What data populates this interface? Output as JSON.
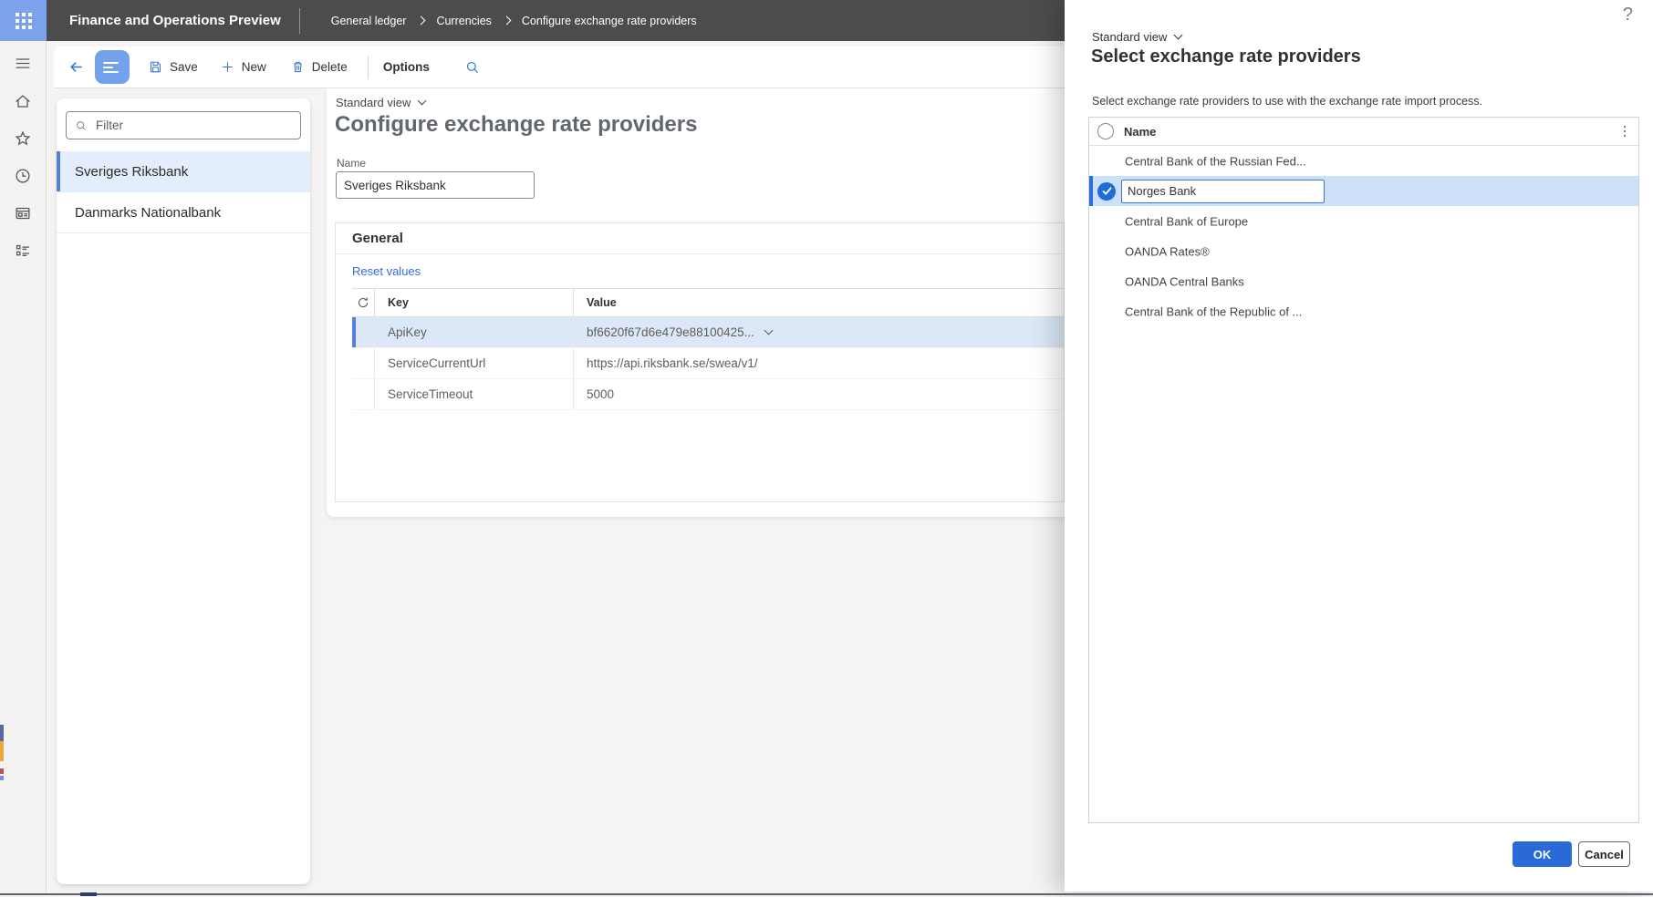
{
  "topbar": {
    "app_title": "Finance and Operations Preview",
    "breadcrumbs": [
      "General ledger",
      "Currencies",
      "Configure exchange rate providers"
    ]
  },
  "toolbar": {
    "save_label": "Save",
    "new_label": "New",
    "delete_label": "Delete",
    "options_label": "Options"
  },
  "nav_icons": [
    "menu-icon",
    "home-icon",
    "favorites-star-icon",
    "recent-clock-icon",
    "workspaces-icon",
    "modules-list-icon"
  ],
  "left_panel": {
    "filter_placeholder": "Filter",
    "items": [
      {
        "label": "Sveriges Riksbank",
        "selected": true
      },
      {
        "label": "Danmarks Nationalbank",
        "selected": false
      }
    ]
  },
  "main": {
    "view_label": "Standard view",
    "page_title": "Configure exchange rate providers",
    "name_label": "Name",
    "name_value": "Sveriges Riksbank",
    "general": {
      "heading": "General",
      "reset_link": "Reset values",
      "table": {
        "key_header": "Key",
        "value_header": "Value",
        "rows": [
          {
            "key": "ApiKey",
            "value": "bf6620f67d6e479e88100425...",
            "selected": true,
            "dropdown": true
          },
          {
            "key": "ServiceCurrentUrl",
            "value": "https://api.riksbank.se/swea/v1/",
            "selected": false,
            "dropdown": false
          },
          {
            "key": "ServiceTimeout",
            "value": "5000",
            "selected": false,
            "dropdown": false
          }
        ]
      }
    }
  },
  "dialog": {
    "view_label": "Standard view",
    "title": "Select exchange rate providers",
    "description": "Select exchange rate providers to use with the exchange rate import process.",
    "name_header": "Name",
    "providers": [
      {
        "name": "Central Bank of the Russian Fed...",
        "selected": false,
        "editing": false
      },
      {
        "name": "Norges Bank",
        "selected": true,
        "editing": true
      },
      {
        "name": "Central Bank of Europe",
        "selected": false,
        "editing": false
      },
      {
        "name": "OANDA Rates®",
        "selected": false,
        "editing": false
      },
      {
        "name": "OANDA Central Banks",
        "selected": false,
        "editing": false
      },
      {
        "name": "Central Bank of the Republic of ...",
        "selected": false,
        "editing": false
      }
    ],
    "ok_label": "OK",
    "cancel_label": "Cancel",
    "help_glyph": "?"
  },
  "colors": {
    "accent_blue": "#2f6edb",
    "topbar_gray": "#4c4c4c",
    "launcher_blue": "#7ba2eb",
    "selected_row_blue": "#dce8f7",
    "dialog_selected_blue": "#cce0f8",
    "ok_button_blue": "#2a6ad8"
  }
}
